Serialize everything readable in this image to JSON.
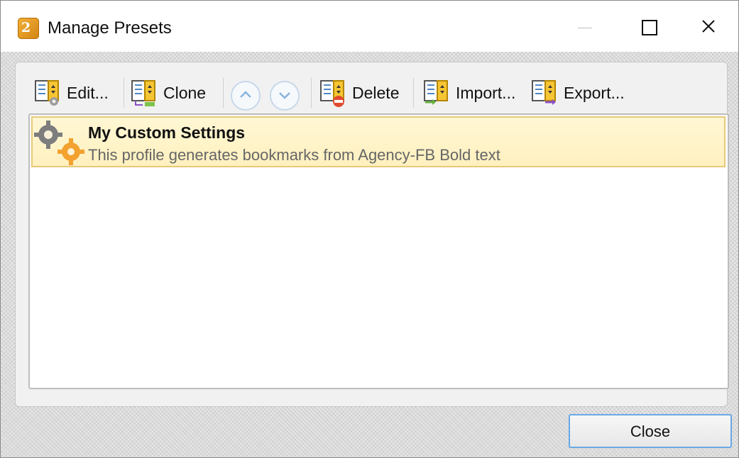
{
  "window": {
    "title": "Manage Presets",
    "icons": [
      "app-icon",
      "minimize-icon",
      "maximize-icon",
      "close-icon"
    ]
  },
  "toolbar": {
    "edit_label": "Edit...",
    "clone_label": "Clone",
    "delete_label": "Delete",
    "import_label": "Import...",
    "export_label": "Export...",
    "icons": [
      "edit-preset-icon",
      "clone-preset-icon",
      "move-up-icon",
      "move-down-icon",
      "delete-preset-icon",
      "import-preset-icon",
      "export-preset-icon"
    ]
  },
  "presets": [
    {
      "title": "My Custom Settings",
      "description": "This profile generates bookmarks from Agency-FB Bold text",
      "icon": "settings-gears-icon",
      "selected": true
    }
  ],
  "footer": {
    "close_label": "Close"
  },
  "colors": {
    "selection_fill": "#fff2c6",
    "selection_border": "#e8c979",
    "accent_blue": "#6aa8e6",
    "icon_orange": "#f3a12f"
  }
}
